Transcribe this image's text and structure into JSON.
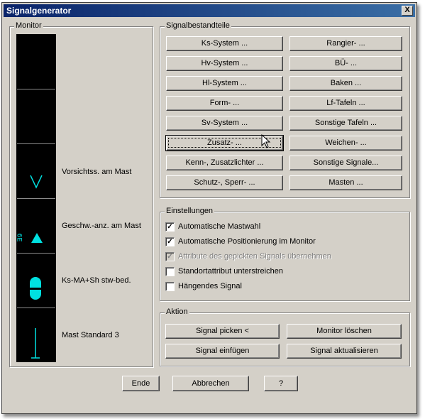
{
  "window": {
    "title": "Signalgenerator",
    "close_label": "X"
  },
  "monitor": {
    "label": "Monitor",
    "rows": [
      {
        "label": ""
      },
      {
        "label": ""
      },
      {
        "label": "Vorsichtss. am Mast"
      },
      {
        "label": "Geschw.-anz. am Mast",
        "glyph": "6E"
      },
      {
        "label": "Ks-MA+Sh stw-bed."
      },
      {
        "label": "Mast Standard 3"
      }
    ],
    "signal_color": "#00e0e0"
  },
  "signalbestandteile": {
    "label": "Signalbestandteile",
    "left": [
      "Ks-System ...",
      "Hv-System ...",
      "Hl-System ...",
      "Form- ...",
      "Sv-System ...",
      "Zusatz- ...",
      "Kenn-, Zusatzlichter ...",
      "Schutz-, Sperr- ..."
    ],
    "right": [
      "Rangier- ...",
      "BÜ- ...",
      "Baken ...",
      "Lf-Tafeln ...",
      "Sonstige Tafeln ...",
      "Weichen- ...",
      "Sonstige Signale...",
      "Masten ..."
    ]
  },
  "einstellungen": {
    "label": "Einstellungen",
    "options": [
      {
        "label": "Automatische Mastwahl",
        "checked": true,
        "disabled": false
      },
      {
        "label": "Automatische Positionierung im Monitor",
        "checked": true,
        "disabled": false
      },
      {
        "label": "Attribute des gepickten Signals übernehmen",
        "checked": true,
        "disabled": true
      },
      {
        "label": "Standortattribut unterstreichen",
        "checked": false,
        "disabled": false
      },
      {
        "label": "Hängendes Signal",
        "checked": false,
        "disabled": false
      }
    ]
  },
  "aktion": {
    "label": "Aktion",
    "buttons": [
      "Signal picken <",
      "Monitor löschen",
      "Signal einfügen",
      "Signal aktualisieren"
    ]
  },
  "footer": {
    "ende": "Ende",
    "abbrechen": "Abbrechen",
    "help": "?"
  }
}
